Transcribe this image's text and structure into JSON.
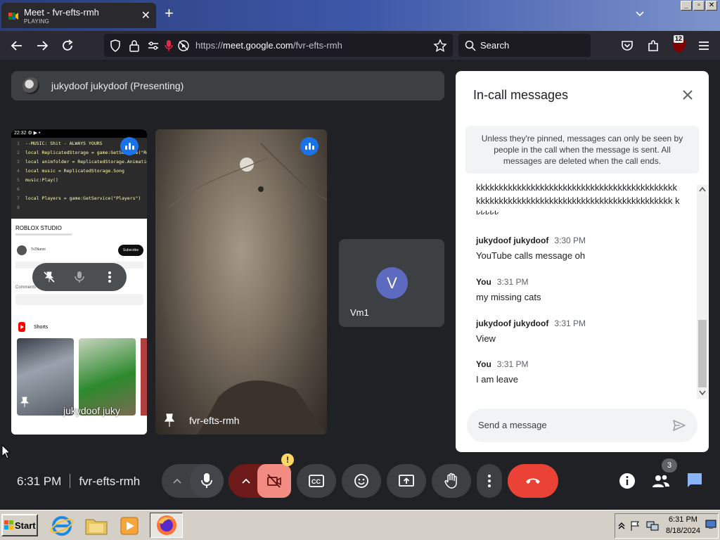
{
  "browser": {
    "tab_title": "Meet - fvr-efts-rmh",
    "tab_status": "PLAYING",
    "url_prefix": "https://",
    "url_domain": "meet.google.com",
    "url_path": "/fvr-efts-rmh",
    "search_placeholder": "Search",
    "notification_badge": "12"
  },
  "meet": {
    "presenter_label": "jukydoof jukydoof (Presenting)",
    "screen_share": {
      "code_lines": [
        {
          "n": "1",
          "code": "--MUSIC: Shit - ALWAYS YOURS"
        },
        {
          "n": "2",
          "code": "local ReplicatedStorage = game:GetService(\"Replicated"
        },
        {
          "n": "3",
          "code": "local animfolder = ReplicatedStorage.AnimationsFolde"
        },
        {
          "n": "4",
          "code": "local music = ReplicatedStorage.Song"
        },
        {
          "n": "5",
          "code": "music:Play()"
        },
        {
          "n": "6",
          "code": ""
        },
        {
          "n": "7",
          "code": "local Players = game:GetService(\"Players\")"
        },
        {
          "n": "8",
          "code": ""
        }
      ],
      "video_title": "ROBLOX STUDIO",
      "channel": "TrZNanni",
      "subscribe": "Subscribe",
      "comments_label": "Comments",
      "shorts_label": "Shorts",
      "overlay_name": "jukydoof juky"
    },
    "camera_tile_name": "fvr-efts-rmh",
    "participant_tile": {
      "initial": "V",
      "name": "Vm1"
    },
    "clock": "6:31 PM",
    "meeting_code": "fvr-efts-rmh",
    "participants_count": "3"
  },
  "chat": {
    "title": "In-call messages",
    "notice": "Unless they're pinned, messages can only be seen by people in the call when the message is sent. All messages are deleted when the call ends.",
    "partial_text": "kkkkkkkkkkkkkkkkkkkkkkkkkkkkkkkkkkkkkkkkkkkk kkkkkkkkkkkkkkkkkkkkkkkkkkkkkkkkkkkkkkkkkkk kkkkkk",
    "messages": [
      {
        "sender": "jukydoof jukydoof",
        "time": "3:30 PM",
        "text": "YouTube calls message oh"
      },
      {
        "sender": "You",
        "time": "3:31 PM",
        "text": "my missing cats"
      },
      {
        "sender": "jukydoof jukydoof",
        "time": "3:31 PM",
        "text": "View"
      },
      {
        "sender": "You",
        "time": "3:31 PM",
        "text": "I am leave"
      }
    ],
    "input_placeholder": "Send a message"
  },
  "taskbar": {
    "start_label": "Start",
    "tray_time": "6:31 PM",
    "tray_date": "8/18/2024"
  },
  "colors": {
    "meet_bg": "#202124",
    "end_call": "#ea4335",
    "camera_off": "#f28b82",
    "accent_blue": "#8ab4f8"
  }
}
